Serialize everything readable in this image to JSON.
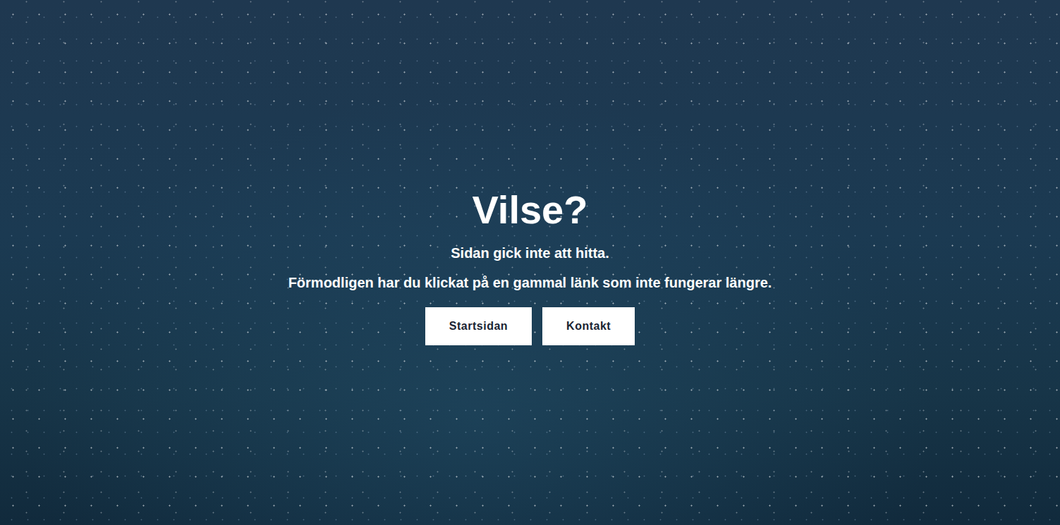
{
  "page": {
    "title": "Vilse?",
    "lines": [
      "Sidan gick inte att hitta.",
      "Förmodligen har du klickat på en gammal länk som inte fungerar längre."
    ]
  },
  "buttons": [
    {
      "label": "Startsidan"
    },
    {
      "label": "Kontakt"
    }
  ]
}
